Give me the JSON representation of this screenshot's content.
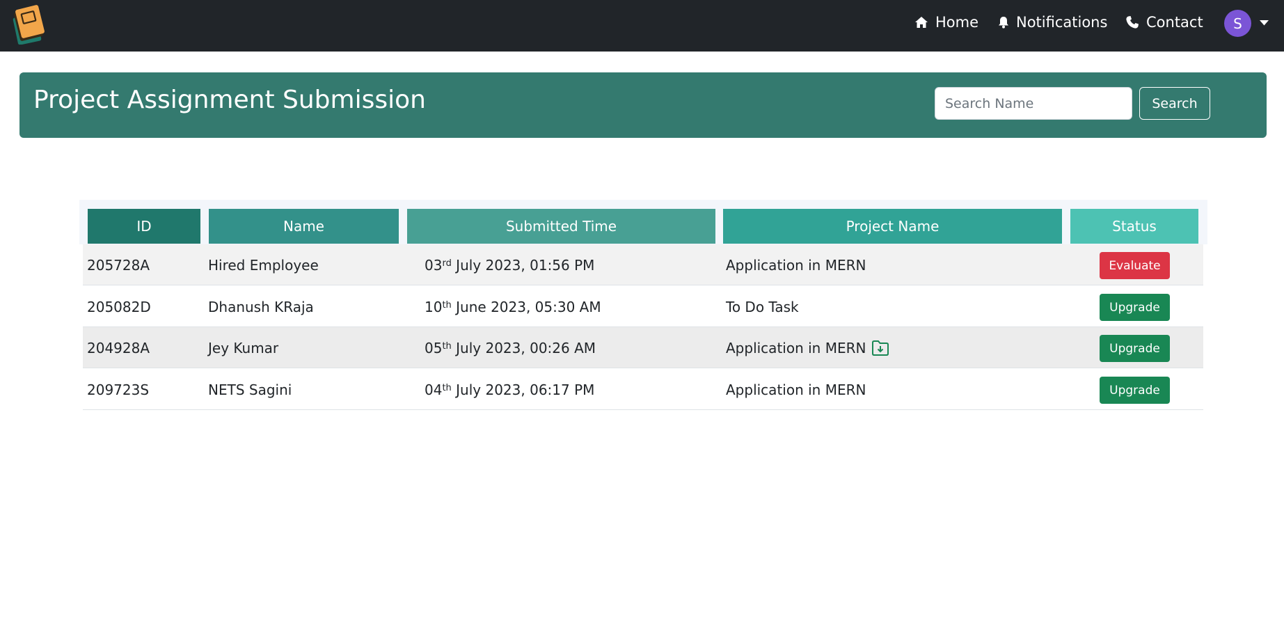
{
  "nav": {
    "home_label": "Home",
    "notifications_label": "Notifications",
    "contact_label": "Contact",
    "avatar_initial": "S"
  },
  "header": {
    "title": "Project Assignment Submission",
    "search_placeholder": "Search Name",
    "search_button": "Search"
  },
  "table": {
    "columns": [
      "ID",
      "Name",
      "Submitted Time",
      "Project Name",
      "Status"
    ],
    "column_colors": [
      "#20786c",
      "#33918a",
      "#48a094",
      "#31a396",
      "#4dc2b3"
    ],
    "rows": [
      {
        "id": "205728A",
        "name": "Hired Employee",
        "day": "03",
        "suffix": "rd",
        "time": " July 2023, 01:56 PM",
        "project": "Application in MERN",
        "status": "Evaluate",
        "status_color": "#dc3545",
        "download": false
      },
      {
        "id": "205082D",
        "name": "Dhanush KRaja",
        "day": "10",
        "suffix": "th",
        "time": " June 2023, 05:30 AM",
        "project": "To Do Task",
        "status": "Upgrade",
        "status_color": "#198754",
        "download": false
      },
      {
        "id": "204928A",
        "name": "Jey Kumar",
        "day": "05",
        "suffix": "th",
        "time": " July 2023, 00:26 AM",
        "project": "Application in MERN",
        "status": "Upgrade",
        "status_color": "#198754",
        "download": true
      },
      {
        "id": "209723S",
        "name": "NETS Sagini",
        "day": "04",
        "suffix": "th",
        "time": " July 2023, 06:17 PM",
        "project": "Application in MERN",
        "status": "Upgrade",
        "status_color": "#198754",
        "download": false
      }
    ]
  },
  "colors": {
    "navbar": "#212529",
    "banner": "#347a6f",
    "avatar": "#7b55d6"
  }
}
